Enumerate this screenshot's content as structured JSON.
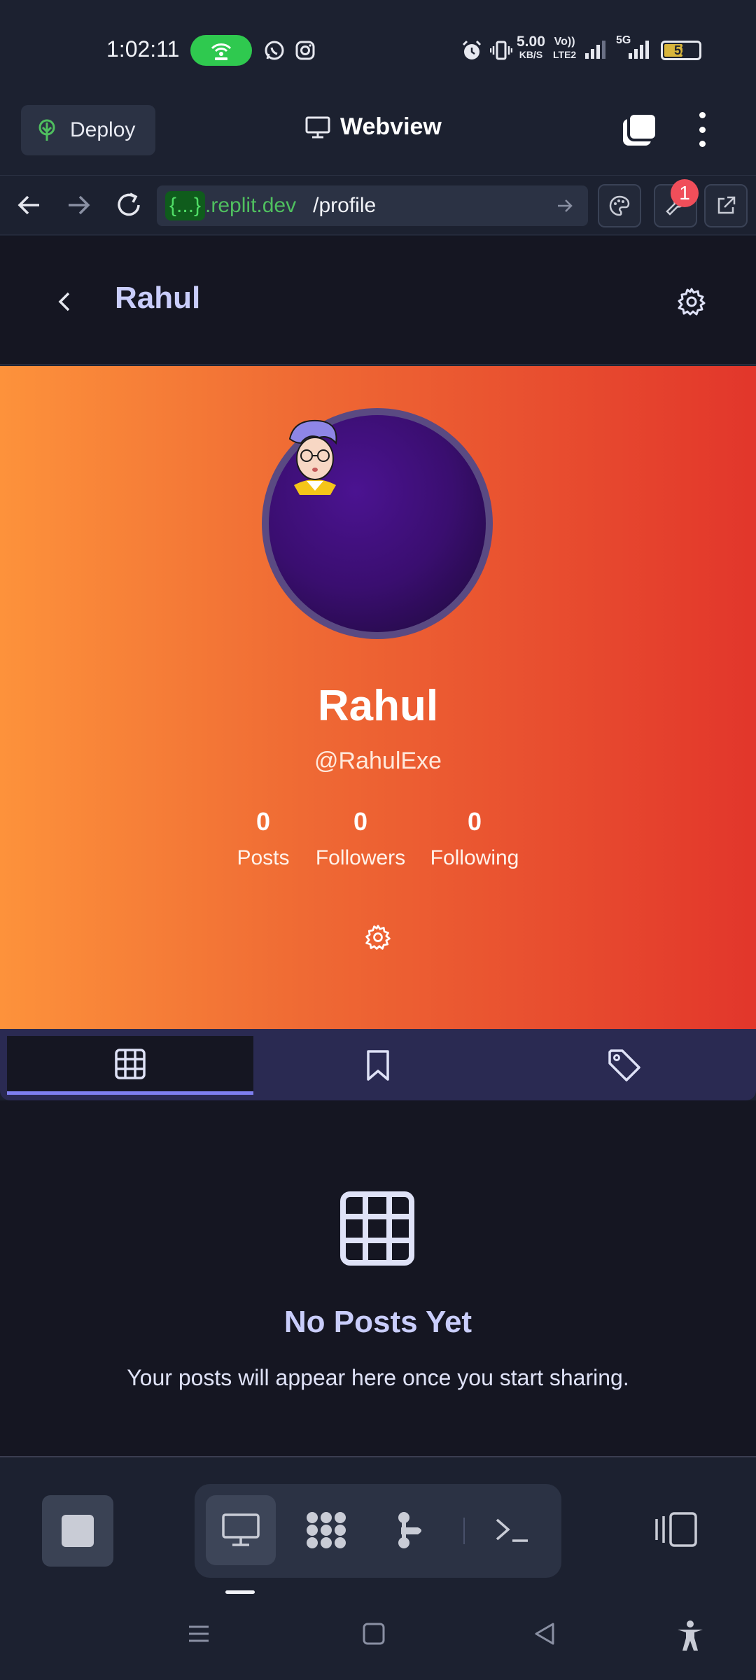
{
  "status_bar": {
    "time": "1:02:11",
    "net_speed_value": "5.00",
    "net_speed_unit": "KB/S",
    "volte_top": "Vo))",
    "volte_bottom": "LTE2",
    "network_type": "5G",
    "battery": "52",
    "icons": [
      "hotspot-icon",
      "whatsapp-icon",
      "instagram-icon",
      "alarm-icon",
      "vibrate-icon",
      "signal-icon",
      "battery-icon"
    ]
  },
  "replit_header": {
    "deploy_label": "Deploy",
    "title": "Webview"
  },
  "url_bar": {
    "badge": "{...}",
    "domain": ".replit.dev",
    "path": "/profile",
    "notification_count": "1"
  },
  "app_header": {
    "title": "Rahul"
  },
  "profile": {
    "name": "Rahul",
    "handle": "@RahulExe",
    "stats": [
      {
        "value": "0",
        "label": "Posts"
      },
      {
        "value": "0",
        "label": "Followers"
      },
      {
        "value": "0",
        "label": "Following"
      }
    ]
  },
  "tabs": {
    "items": [
      "grid-icon",
      "bookmark-icon",
      "tag-icon"
    ],
    "active_index": 0
  },
  "empty_state": {
    "title": "No Posts Yet",
    "subtitle": "Your posts will appear here once you start sharing."
  },
  "colors": {
    "banner_start": "#fd923b",
    "banner_end": "#e2362b",
    "accent": "#7f7ff0",
    "title_text": "#c9cdfb",
    "background": "#151622"
  }
}
